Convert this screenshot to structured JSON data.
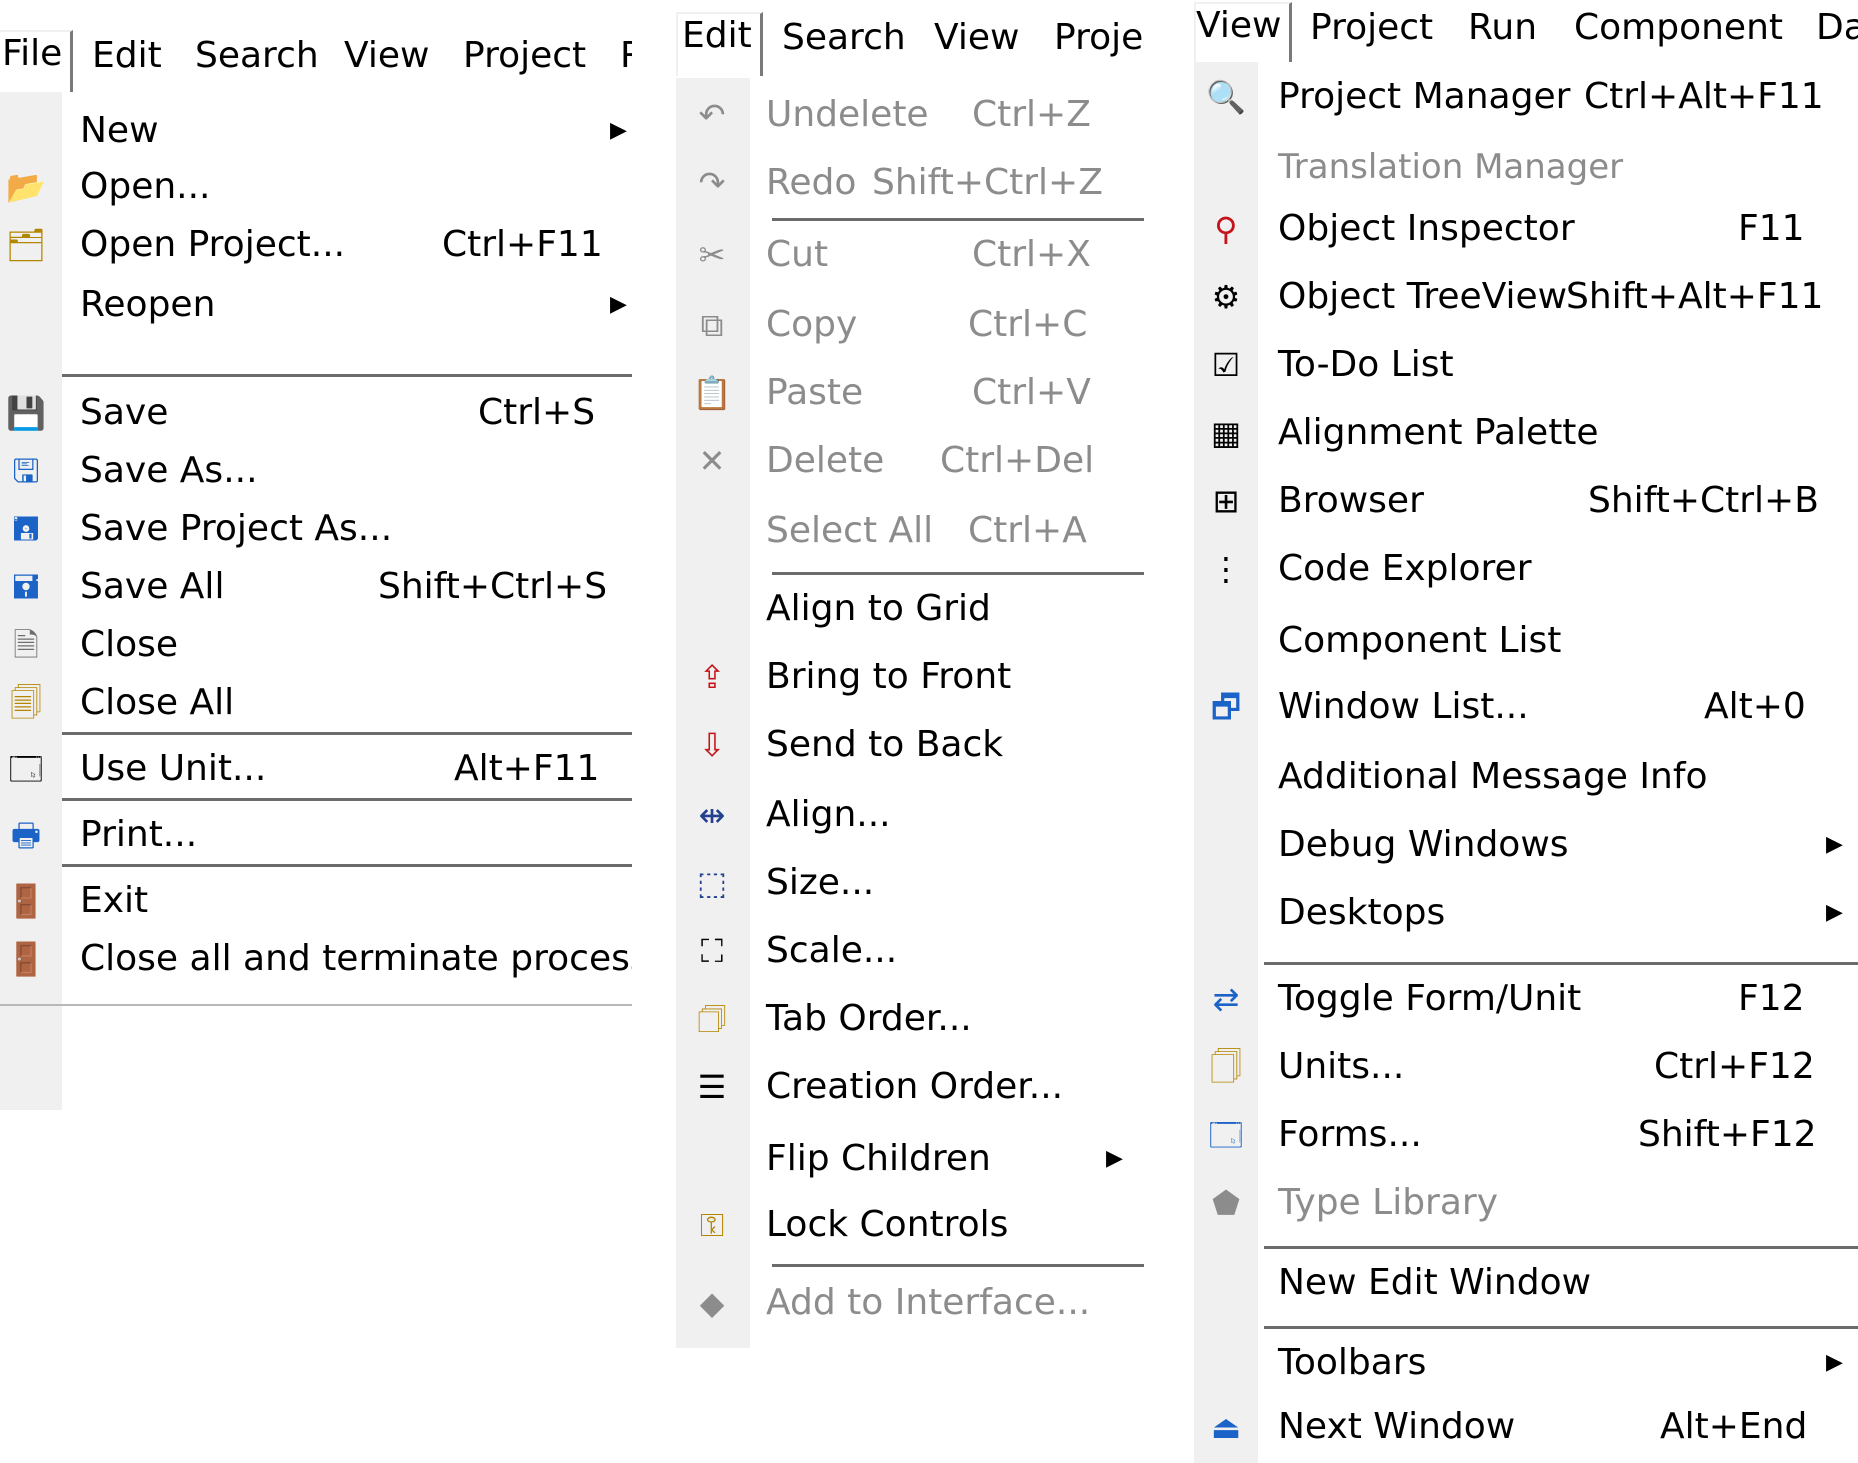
{
  "file_panel": {
    "menubar": [
      "File",
      "Edit",
      "Search",
      "View",
      "Project",
      "R"
    ],
    "items": [
      {
        "label": "New",
        "shortcut": "",
        "submenu": true,
        "icon": "blank"
      },
      {
        "label": "Open...",
        "shortcut": "",
        "submenu": false,
        "icon": "open-folder-icon"
      },
      {
        "label": "Open Project...",
        "shortcut": "Ctrl+F11",
        "submenu": false,
        "icon": "open-project-icon"
      },
      {
        "label": "Reopen",
        "shortcut": "",
        "submenu": true,
        "icon": "blank"
      },
      {
        "label": "Save",
        "shortcut": "Ctrl+S",
        "submenu": false,
        "icon": "save-icon"
      },
      {
        "label": "Save As...",
        "shortcut": "",
        "submenu": false,
        "icon": "save-as-icon"
      },
      {
        "label": "Save Project As...",
        "shortcut": "",
        "submenu": false,
        "icon": "save-project-as-icon"
      },
      {
        "label": "Save All",
        "shortcut": "Shift+Ctrl+S",
        "submenu": false,
        "icon": "save-all-icon"
      },
      {
        "label": "Close",
        "shortcut": "",
        "submenu": false,
        "icon": "close-file-icon"
      },
      {
        "label": "Close All",
        "shortcut": "",
        "submenu": false,
        "icon": "close-all-icon"
      },
      {
        "label": "Use Unit...",
        "shortcut": "Alt+F11",
        "submenu": false,
        "icon": "use-unit-icon"
      },
      {
        "label": "Print...",
        "shortcut": "",
        "submenu": false,
        "icon": "printer-icon"
      },
      {
        "label": "Exit",
        "shortcut": "",
        "submenu": false,
        "icon": "exit-door-icon"
      },
      {
        "label": "Close all and terminate process",
        "shortcut": "",
        "submenu": false,
        "icon": "exit-door-icon"
      }
    ]
  },
  "edit_panel": {
    "menubar": [
      "Edit",
      "Search",
      "View",
      "Projec"
    ],
    "items": [
      {
        "label": "Undelete",
        "shortcut": "Ctrl+Z",
        "disabled": true,
        "icon": "undo-icon"
      },
      {
        "label": "Redo",
        "shortcut": "Shift+Ctrl+Z",
        "disabled": true,
        "icon": "redo-icon"
      },
      {
        "label": "Cut",
        "shortcut": "Ctrl+X",
        "disabled": true,
        "icon": "scissors-icon"
      },
      {
        "label": "Copy",
        "shortcut": "Ctrl+C",
        "disabled": true,
        "icon": "copy-icon"
      },
      {
        "label": "Paste",
        "shortcut": "Ctrl+V",
        "disabled": true,
        "icon": "paste-icon"
      },
      {
        "label": "Delete",
        "shortcut": "Ctrl+Del",
        "disabled": true,
        "icon": "delete-x-icon"
      },
      {
        "label": "Select All",
        "shortcut": "Ctrl+A",
        "disabled": true,
        "icon": "blank"
      },
      {
        "label": "Align to Grid",
        "shortcut": "",
        "disabled": false,
        "icon": "blank"
      },
      {
        "label": "Bring to Front",
        "shortcut": "",
        "disabled": false,
        "icon": "bring-to-front-icon"
      },
      {
        "label": "Send to Back",
        "shortcut": "",
        "disabled": false,
        "icon": "send-to-back-icon"
      },
      {
        "label": "Align...",
        "shortcut": "",
        "disabled": false,
        "icon": "align-icon"
      },
      {
        "label": "Size...",
        "shortcut": "",
        "disabled": false,
        "icon": "size-icon"
      },
      {
        "label": "Scale...",
        "shortcut": "",
        "disabled": false,
        "icon": "scale-icon"
      },
      {
        "label": "Tab Order...",
        "shortcut": "",
        "disabled": false,
        "icon": "tab-order-icon"
      },
      {
        "label": "Creation Order...",
        "shortcut": "",
        "disabled": false,
        "icon": "creation-order-icon"
      },
      {
        "label": "Flip Children",
        "shortcut": "",
        "disabled": false,
        "submenu": true,
        "icon": "blank"
      },
      {
        "label": "Lock Controls",
        "shortcut": "",
        "disabled": false,
        "icon": "key-icon"
      },
      {
        "label": "Add to Interface...",
        "shortcut": "",
        "disabled": true,
        "icon": "add-interface-icon"
      }
    ]
  },
  "view_panel": {
    "menubar": [
      "View",
      "Project",
      "Run",
      "Component",
      "Da"
    ],
    "items": [
      {
        "label": "Project Manager",
        "shortcut": "Ctrl+Alt+F11",
        "icon": "project-manager-icon"
      },
      {
        "label": "Translation Manager",
        "shortcut": "",
        "disabled": true,
        "icon": "blank"
      },
      {
        "label": "Object Inspector",
        "shortcut": "F11",
        "icon": "object-inspector-icon"
      },
      {
        "label": "Object TreeView",
        "shortcut": "Shift+Alt+F11",
        "icon": "object-treeview-icon"
      },
      {
        "label": "To-Do List",
        "shortcut": "",
        "icon": "todo-list-icon"
      },
      {
        "label": "Alignment Palette",
        "shortcut": "",
        "icon": "alignment-palette-icon"
      },
      {
        "label": "Browser",
        "shortcut": "Shift+Ctrl+B",
        "icon": "browser-tree-icon"
      },
      {
        "label": "Code Explorer",
        "shortcut": "",
        "icon": "code-explorer-icon"
      },
      {
        "label": "Component List",
        "shortcut": "",
        "icon": "blank"
      },
      {
        "label": "Window List...",
        "shortcut": "Alt+0",
        "icon": "window-list-icon"
      },
      {
        "label": "Additional Message Info",
        "shortcut": "",
        "icon": "blank"
      },
      {
        "label": "Debug Windows",
        "shortcut": "",
        "submenu": true,
        "icon": "blank"
      },
      {
        "label": "Desktops",
        "shortcut": "",
        "submenu": true,
        "icon": "blank"
      },
      {
        "label": "Toggle Form/Unit",
        "shortcut": "F12",
        "icon": "toggle-form-unit-icon"
      },
      {
        "label": "Units...",
        "shortcut": "Ctrl+F12",
        "icon": "units-icon"
      },
      {
        "label": "Forms...",
        "shortcut": "Shift+F12",
        "icon": "forms-icon"
      },
      {
        "label": "Type Library",
        "shortcut": "",
        "disabled": true,
        "icon": "type-library-icon"
      },
      {
        "label": "New Edit Window",
        "shortcut": "",
        "icon": "blank"
      },
      {
        "label": "Toolbars",
        "shortcut": "",
        "submenu": true,
        "icon": "blank"
      },
      {
        "label": "Next Window",
        "shortcut": "Alt+End",
        "icon": "next-window-icon"
      }
    ]
  },
  "colors": {
    "gutter": "#f0f0f0",
    "disabled_text": "#8c8c8c",
    "separator": "#6b6b6b"
  }
}
